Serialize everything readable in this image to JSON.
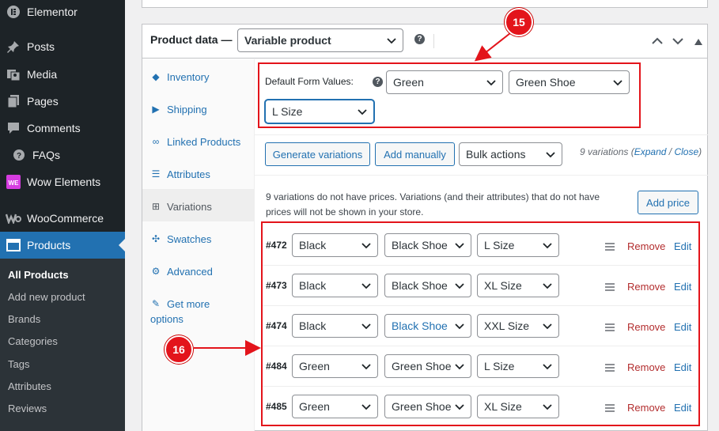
{
  "sidebar": {
    "items": [
      {
        "label": "Elementor",
        "icon": "elementor-icon"
      },
      {
        "label": "Posts",
        "icon": "pin-icon"
      },
      {
        "label": "Media",
        "icon": "media-icon"
      },
      {
        "label": "Pages",
        "icon": "pages-icon"
      },
      {
        "label": "Comments",
        "icon": "comments-icon"
      },
      {
        "label": "FAQs",
        "icon": "question-icon"
      },
      {
        "label": "Wow Elements",
        "icon": "wow-elements-icon"
      },
      {
        "label": "WooCommerce",
        "icon": "woocommerce-icon"
      },
      {
        "label": "Products",
        "icon": "products-icon"
      }
    ],
    "submenu": [
      "All Products",
      "Add new product",
      "Brands",
      "Categories",
      "Tags",
      "Attributes",
      "Reviews"
    ]
  },
  "product_data": {
    "title": "Product data —",
    "type_value": "Variable product"
  },
  "tabs": [
    "Inventory",
    "Shipping",
    "Linked Products",
    "Attributes",
    "Variations",
    "Swatches",
    "Advanced",
    "Get more",
    "options"
  ],
  "default_form": {
    "label": "Default Form Values:",
    "values": [
      "Green",
      "Green Shoe",
      "L Size"
    ]
  },
  "toolbar": {
    "generate": "Generate variations",
    "add_manually": "Add manually",
    "bulk_actions": "Bulk actions",
    "count": "9 variations",
    "expand": "Expand",
    "slash": "/",
    "close": "Close",
    "paren_open": "(",
    "paren_close": ")"
  },
  "notice": {
    "line1": "9 variations do not have prices. Variations (and their attributes) that do not have",
    "line2": "prices will not be shown in your store.",
    "add_price": "Add price"
  },
  "variations": [
    {
      "id": "#472",
      "color": "Black",
      "shoe": "Black Shoe",
      "size": "L Size"
    },
    {
      "id": "#473",
      "color": "Black",
      "shoe": "Black Shoe",
      "size": "XL Size"
    },
    {
      "id": "#474",
      "color": "Black",
      "shoe": "Black Shoe",
      "size": "XXL Size"
    },
    {
      "id": "#484",
      "color": "Green",
      "shoe": "Green Shoe",
      "size": "L Size"
    },
    {
      "id": "#485",
      "color": "Green",
      "shoe": "Green Shoe",
      "size": "XL Size"
    }
  ],
  "row_actions": {
    "remove": "Remove",
    "edit": "Edit"
  },
  "callouts": [
    "15",
    "16"
  ],
  "colors": {
    "accent": "#2271b1",
    "annotation": "#e3141b",
    "sidebar": "#1d2327"
  }
}
